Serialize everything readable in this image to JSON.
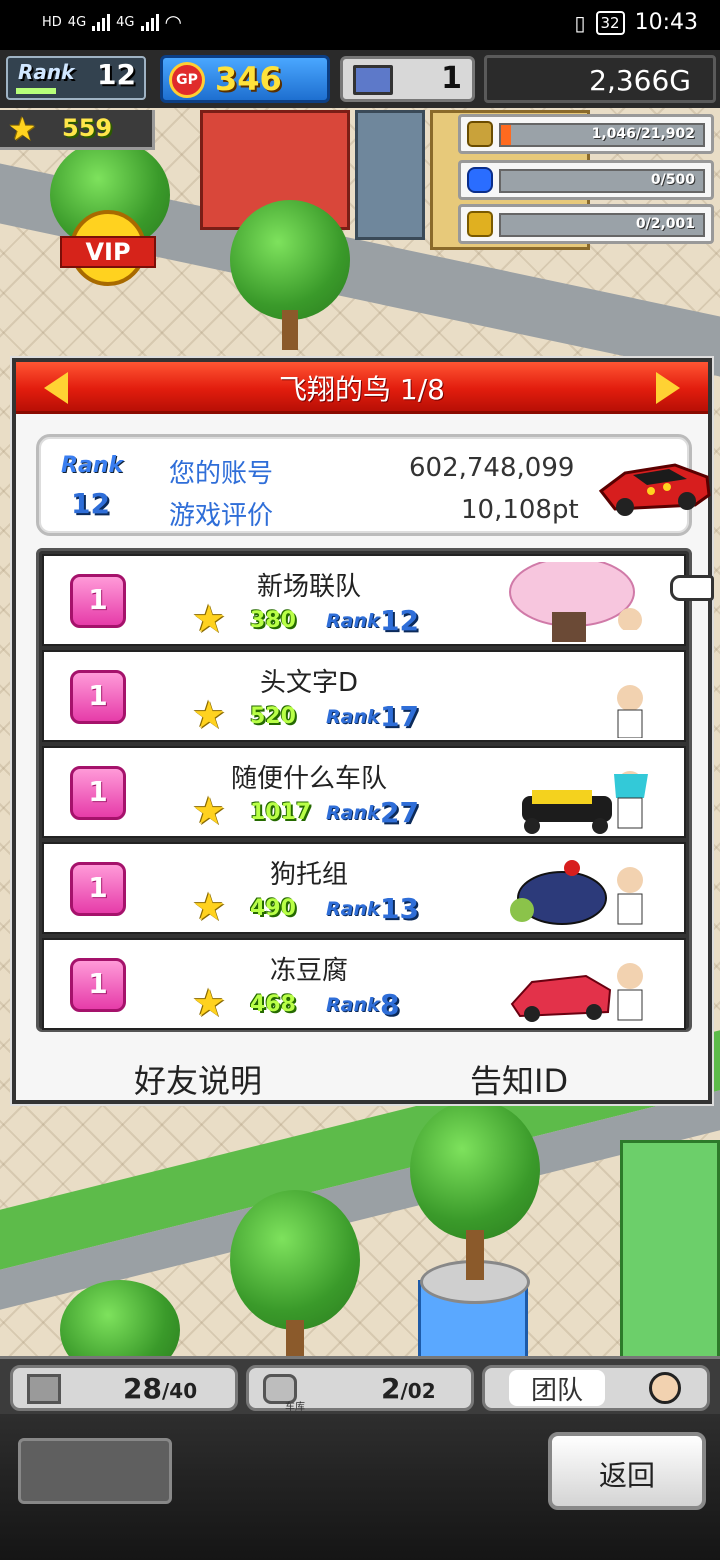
{
  "status_bar": {
    "network": "HD",
    "signal_1": "4G",
    "signal_2": "4G",
    "battery": "32",
    "time": "10:43"
  },
  "hud": {
    "rank_label": "Rank",
    "rank_value": "12",
    "gp_label": "GP",
    "gp_value": "346",
    "pc_value": "1",
    "money": "2,366G",
    "stars": "559",
    "resources": [
      {
        "icon": "coin-stack-icon",
        "value": "1,046/21,902",
        "ratio": 0.048,
        "color": "#ff6a1f"
      },
      {
        "icon": "fuel-drop-icon",
        "value": "0/500",
        "ratio": 0,
        "color": "#2a6dff"
      },
      {
        "icon": "wheat-icon",
        "value": "0/2,001",
        "ratio": 0,
        "color": "#e0b020"
      }
    ]
  },
  "world": {
    "vip_sign": "VIP"
  },
  "dialog": {
    "title": "飞翔的鸟 1/8",
    "account": {
      "rank_label": "Rank",
      "rank_value": "12",
      "account_label": "您的账号",
      "account_value": "602,748,099",
      "rating_label": "游戏评价",
      "rating_value": "10,108pt"
    },
    "teams": [
      {
        "badge": "1",
        "name": "新场联队",
        "stars": "380",
        "rank_label": "Rank",
        "rank": "12",
        "art": "cherry-tree"
      },
      {
        "badge": "1",
        "name": "头文字D",
        "stars": "520",
        "rank_label": "Rank",
        "rank": "17",
        "art": "driver"
      },
      {
        "badge": "1",
        "name": "随便什么车队",
        "stars": "1017",
        "rank_label": "Rank",
        "rank": "27",
        "art": "kart"
      },
      {
        "badge": "1",
        "name": "狗托组",
        "stars": "490",
        "rank_label": "Rank",
        "rank": "13",
        "art": "turtle"
      },
      {
        "badge": "1",
        "name": "冻豆腐",
        "stars": "468",
        "rank_label": "Rank",
        "rank": "8",
        "art": "convertible"
      }
    ],
    "footer": {
      "friends_help": "好友说明",
      "tell_id": "告知ID"
    }
  },
  "bottom_bar": {
    "tab1_value": "28",
    "tab1_max": "/40",
    "tab2_label": "车库",
    "tab2_value": "2",
    "tab2_max": "/02",
    "tab3_label": "团队",
    "back_label": "返回"
  }
}
